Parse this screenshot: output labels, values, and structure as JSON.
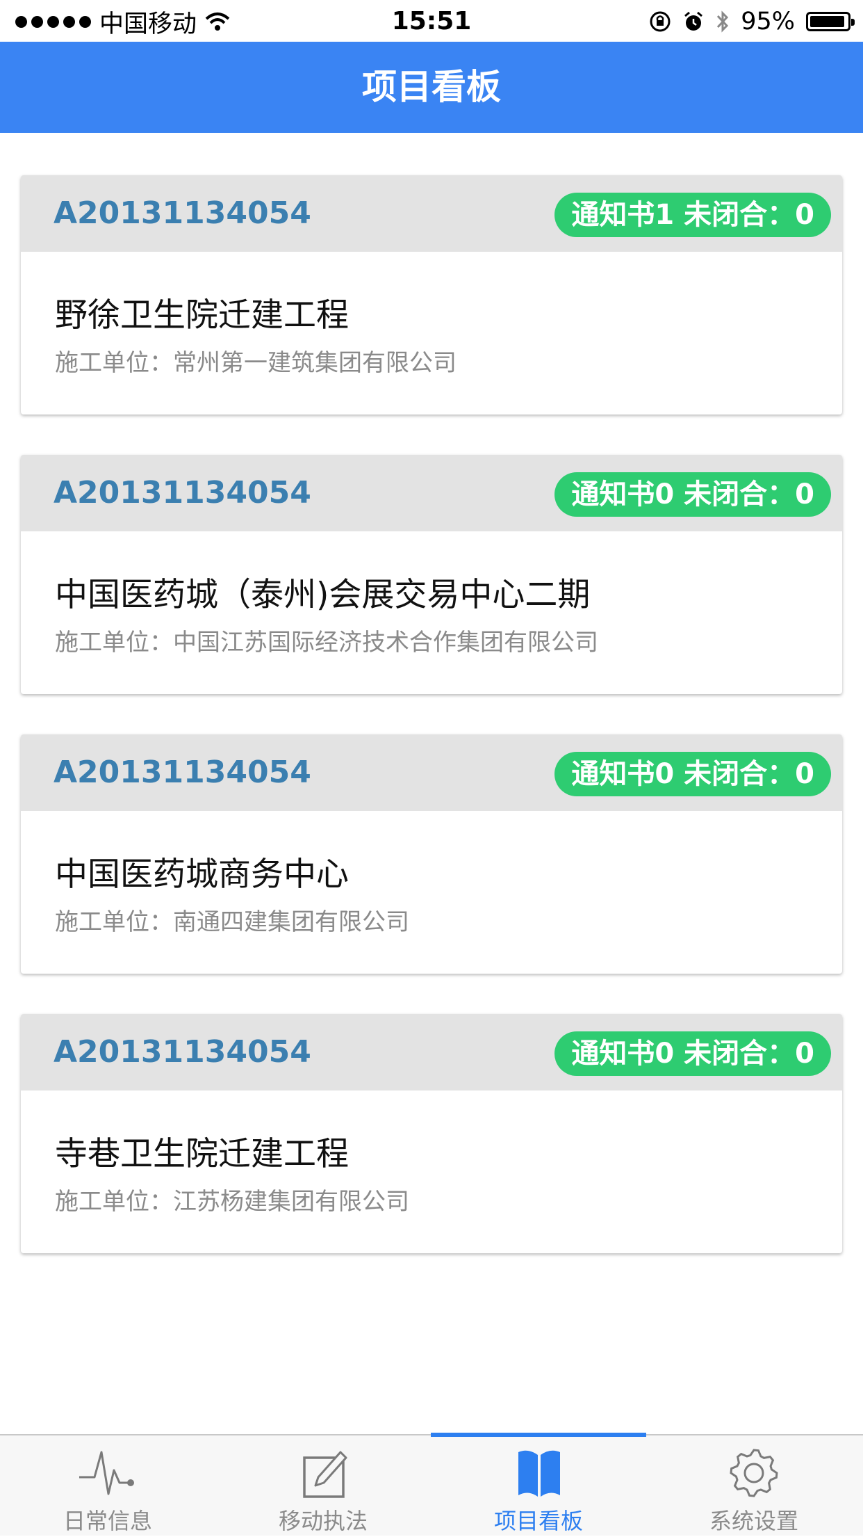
{
  "status_bar": {
    "carrier": "中国移动",
    "time": "15:51",
    "battery": "95%",
    "battery_level": 0.95,
    "icons": [
      "signal-dots-icon",
      "wifi-icon",
      "orientation-lock-icon",
      "alarm-icon",
      "bluetooth-icon",
      "battery-icon"
    ]
  },
  "header": {
    "title": "项目看板"
  },
  "projects": [
    {
      "code": "A20131134054",
      "badge": "通知书1 未闭合：0",
      "name": "野徐卫生院迁建工程",
      "unit": "施工单位：常州第一建筑集团有限公司"
    },
    {
      "code": "A20131134054",
      "badge": "通知书0 未闭合：0",
      "name": "中国医药城（泰州)会展交易中心二期",
      "unit": "施工单位：中国江苏国际经济技术合作集团有限公司"
    },
    {
      "code": "A20131134054",
      "badge": "通知书0 未闭合：0",
      "name": "中国医药城商务中心",
      "unit": "施工单位：南通四建集团有限公司"
    },
    {
      "code": "A20131134054",
      "badge": "通知书0 未闭合：0",
      "name": "寺巷卫生院迁建工程",
      "unit": "施工单位：江苏杨建集团有限公司"
    }
  ],
  "tabs": [
    {
      "label": "日常信息",
      "icon": "pulse-icon"
    },
    {
      "label": "移动执法",
      "icon": "edit-icon"
    },
    {
      "label": "项目看板",
      "icon": "book-icon"
    },
    {
      "label": "系统设置",
      "icon": "gear-icon"
    }
  ],
  "colors": {
    "nav": "#3a84f3",
    "badge": "#2ecc71",
    "code": "#3b7fb0",
    "active_tab": "#2d7ff0"
  }
}
